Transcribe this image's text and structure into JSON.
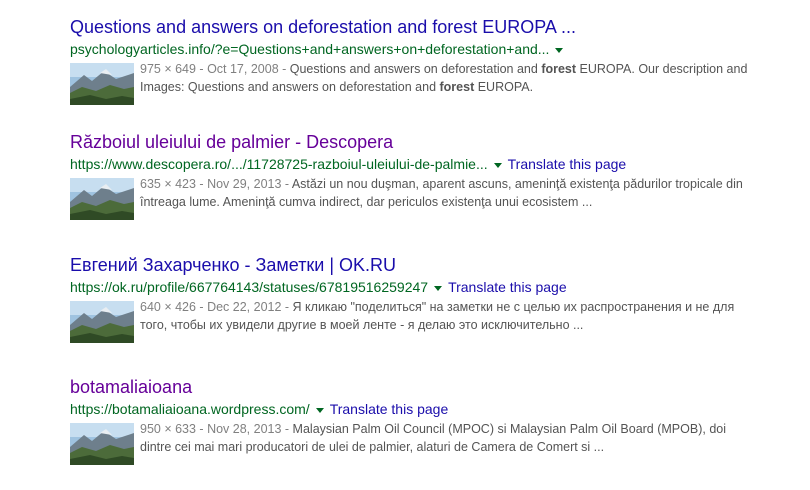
{
  "results": [
    {
      "title": "Questions and answers on deforestation and forest EUROPA ...",
      "url": "psychologyarticles.info/?e=Questions+and+answers+on+deforestation+and...",
      "translate": "",
      "meta": "975 × 649 - Oct 17, 2008 - ",
      "snippet_parts": [
        {
          "text": "Questions and answers on deforestation and ",
          "bold": false
        },
        {
          "text": "forest",
          "bold": true
        },
        {
          "text": " EUROPA. Our description and Images: Questions and answers on deforestation and ",
          "bold": false
        },
        {
          "text": "forest",
          "bold": true
        },
        {
          "text": " EUROPA.",
          "bold": false
        }
      ]
    },
    {
      "title": "Războiul uleiului de palmier - Descopera",
      "url": "https://www.descopera.ro/.../11728725-razboiul-uleiului-de-palmie...",
      "translate": "Translate this page",
      "meta": "635 × 423 - Nov 29, 2013 - ",
      "snippet_parts": [
        {
          "text": "Astăzi un nou duşman, aparent ascuns, ameninţă existenţa pădurilor tropicale din întreaga lume. Ameninţă cumva indirect, dar periculos existenţa unui ecosistem ...",
          "bold": false
        }
      ]
    },
    {
      "title": "Евгений Захарченко - Заметки | OK.RU",
      "url": "https://ok.ru/profile/667764143/statuses/67819516259247",
      "translate": "Translate this page",
      "meta": "640 × 426 - Dec 22, 2012 - ",
      "snippet_parts": [
        {
          "text": "Я кликаю \"поделиться\" на заметки не с целью их распространения и не для того, чтобы их увидели другие в моей ленте - я делаю это исключительно ...",
          "bold": false
        }
      ]
    },
    {
      "title": "botamaliaioana",
      "url": "https://botamaliaioana.wordpress.com/",
      "translate": "Translate this page",
      "meta": "950 × 633 - Nov 28, 2013 - ",
      "snippet_parts": [
        {
          "text": "Malaysian Palm Oil Council (MPOC) si Malaysian Palm Oil Board (MPOB), doi dintre cei mai mari producatori de ulei de palmier, alaturi de Camera de Comert si ...",
          "bold": false
        }
      ]
    }
  ],
  "colors": {
    "link": "#1a0dab",
    "visited": "#660099",
    "url": "#006621",
    "snippet": "#545454",
    "meta": "#808080"
  },
  "icons": {
    "caret": "caret-down-icon",
    "thumbnail": "landscape-thumbnail"
  }
}
